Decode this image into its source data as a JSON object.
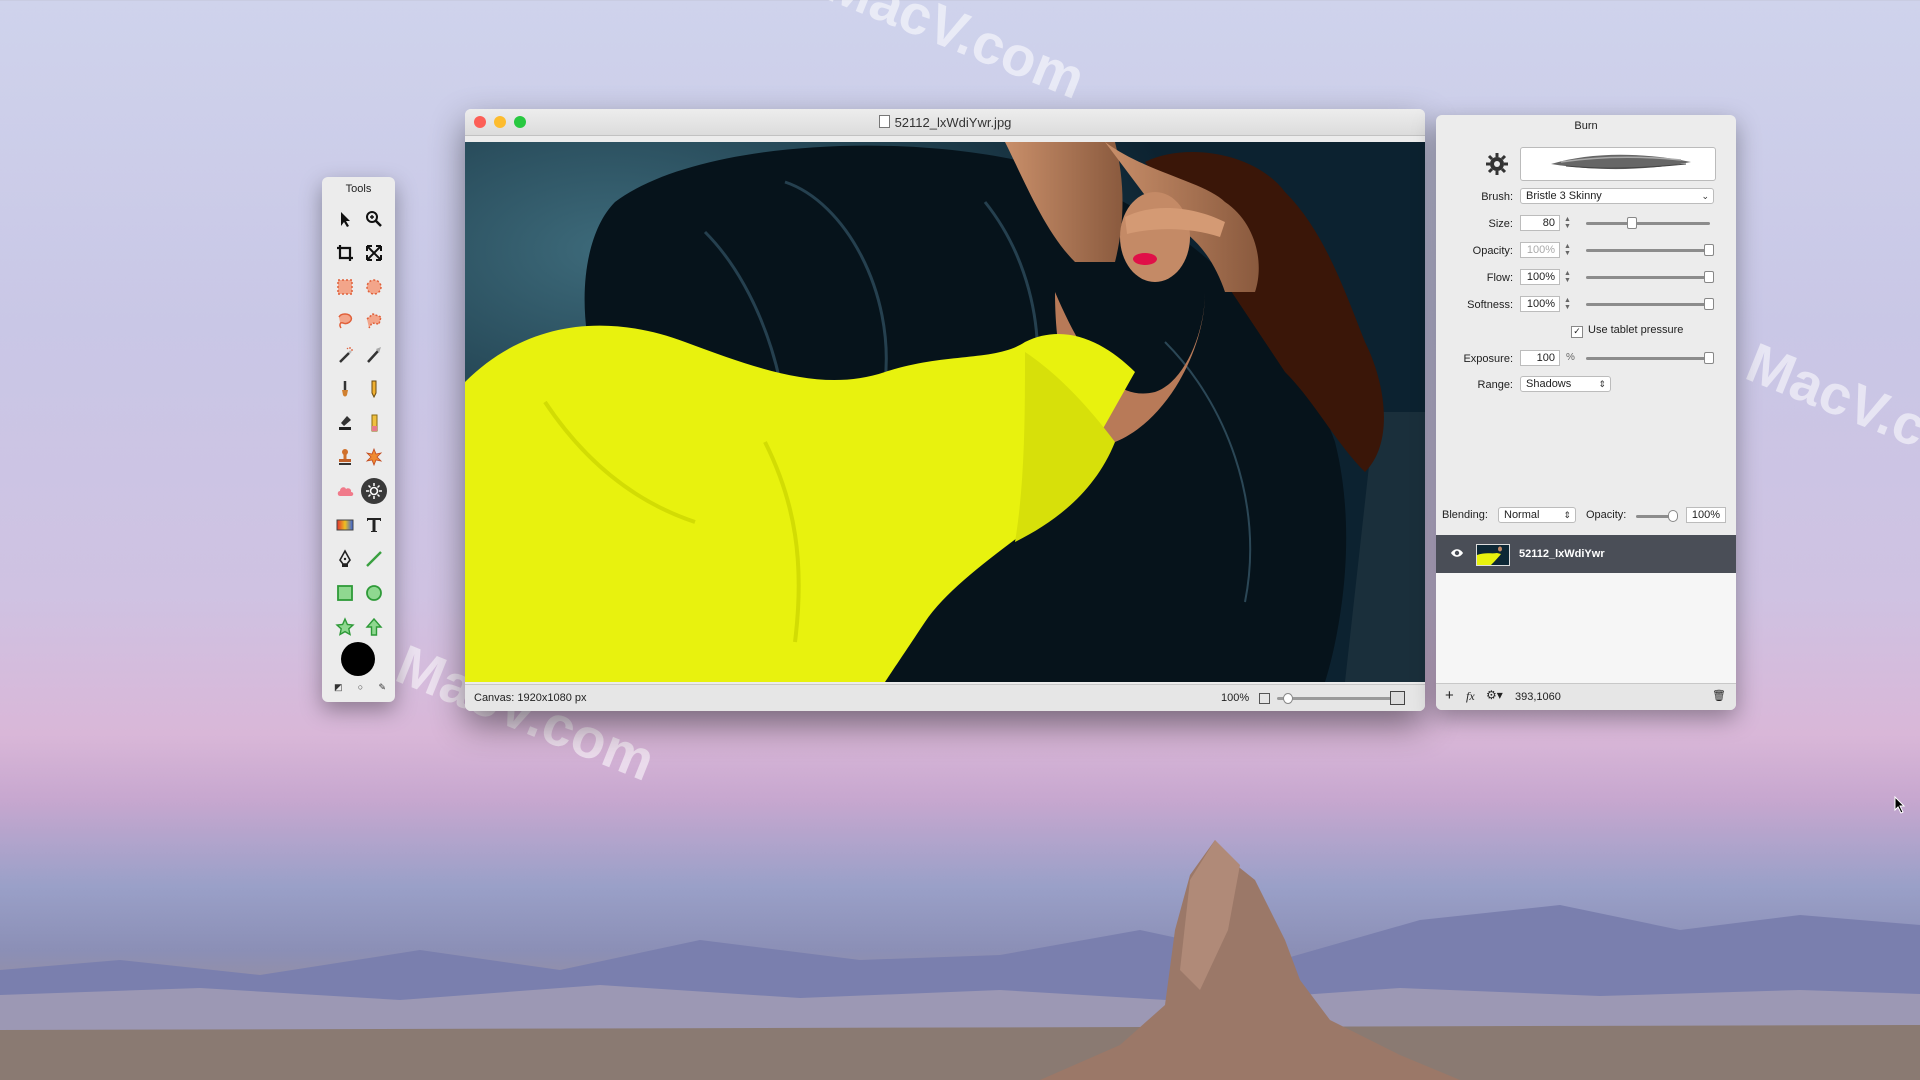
{
  "desktop": {
    "watermark": "MacV.com"
  },
  "tools_palette": {
    "title": "Tools",
    "tools": [
      {
        "name": "arrow-tool",
        "icon": "arrow-icon"
      },
      {
        "name": "zoom-tool",
        "icon": "magnifier-icon"
      },
      {
        "name": "crop-tool",
        "icon": "crop-icon"
      },
      {
        "name": "transform-tool",
        "icon": "transform-arrows-icon"
      },
      {
        "name": "rect-select-tool",
        "icon": "rect-marquee-icon"
      },
      {
        "name": "ellipse-select-tool",
        "icon": "ellipse-marquee-icon"
      },
      {
        "name": "lasso-tool",
        "icon": "lasso-icon"
      },
      {
        "name": "polygon-lasso-tool",
        "icon": "polygon-lasso-icon"
      },
      {
        "name": "magic-wand-tool",
        "icon": "magic-wand-icon"
      },
      {
        "name": "quick-select-tool",
        "icon": "quick-select-icon"
      },
      {
        "name": "brush-tool",
        "icon": "brush-icon"
      },
      {
        "name": "pencil-tool",
        "icon": "pencil-icon"
      },
      {
        "name": "clone-stamp-tool",
        "icon": "clone-stamp-icon"
      },
      {
        "name": "eraser-tool",
        "icon": "eraser-icon"
      },
      {
        "name": "stamp-tool",
        "icon": "stamp-icon"
      },
      {
        "name": "heal-tool",
        "icon": "heal-icon"
      },
      {
        "name": "smudge-tool",
        "icon": "cloud-icon"
      },
      {
        "name": "burn-tool",
        "icon": "sun-icon",
        "active": true
      },
      {
        "name": "gradient-tool",
        "icon": "gradient-icon"
      },
      {
        "name": "text-tool",
        "icon": "text-icon"
      },
      {
        "name": "pen-tool",
        "icon": "pen-nib-icon"
      },
      {
        "name": "line-tool",
        "icon": "line-icon"
      },
      {
        "name": "rectangle-tool",
        "icon": "rectangle-shape-icon"
      },
      {
        "name": "ellipse-tool",
        "icon": "circle-shape-icon"
      },
      {
        "name": "star-tool",
        "icon": "star-icon"
      },
      {
        "name": "arrow-shape-tool",
        "icon": "up-arrow-icon"
      }
    ],
    "primary_color": "#000000"
  },
  "document": {
    "title": "52112_lxWdiYwr.jpg",
    "status_canvas": "Canvas: 1920x1080 px",
    "zoom": "100%",
    "zoom_fraction": 0.05,
    "colors": {
      "dress": "#e8f20e",
      "background": "#0e2836",
      "chair": "#07141d"
    }
  },
  "inspector": {
    "title": "Burn",
    "brush_label": "Brush:",
    "brush_value": "Bristle 3 Skinny",
    "size_label": "Size:",
    "size_value": "80",
    "size_fraction": 0.35,
    "opacity_label": "Opacity:",
    "opacity_value": "100%",
    "opacity_fraction": 1.0,
    "flow_label": "Flow:",
    "flow_value": "100%",
    "flow_fraction": 1.0,
    "softness_label": "Softness:",
    "softness_value": "100%",
    "softness_fraction": 1.0,
    "tablet_pressure_label": "Use tablet pressure",
    "tablet_pressure_checked": true,
    "exposure_label": "Exposure:",
    "exposure_value": "100",
    "exposure_unit": "%",
    "exposure_fraction": 1.0,
    "range_label": "Range:",
    "range_value": "Shadows",
    "blending_label": "Blending:",
    "blending_value": "Normal",
    "layer_opacity_label": "Opacity:",
    "layer_opacity_value": "100%",
    "layer_opacity_fraction": 1.0,
    "layer_name": "52112_lxWdiYwr",
    "footer_coords": "393,1060"
  }
}
